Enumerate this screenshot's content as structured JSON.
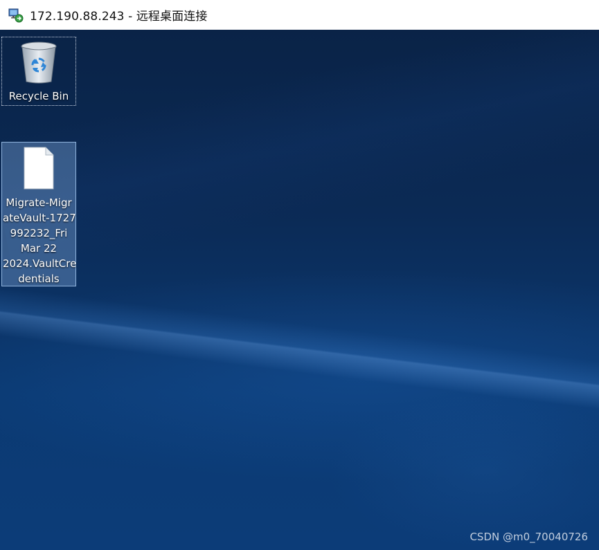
{
  "window": {
    "title": "172.190.88.243 - 远程桌面连接",
    "icon": "remote-desktop-icon"
  },
  "desktop": {
    "icons": [
      {
        "name": "Recycle Bin",
        "icon": "recycle-bin-icon",
        "selected": false,
        "focused": true
      },
      {
        "name_lines": [
          "Migrate-Migr",
          "ateVault-1727",
          "992232_Fri",
          "Mar 22",
          "2024.VaultCre",
          "dentials"
        ],
        "icon": "file-icon",
        "selected": true
      }
    ]
  },
  "watermark": "CSDN @m0_70040726",
  "colors": {
    "titlebar_bg": "#ffffff",
    "desktop_bg": "#0b2a55",
    "selection": "#7aa3d6"
  }
}
